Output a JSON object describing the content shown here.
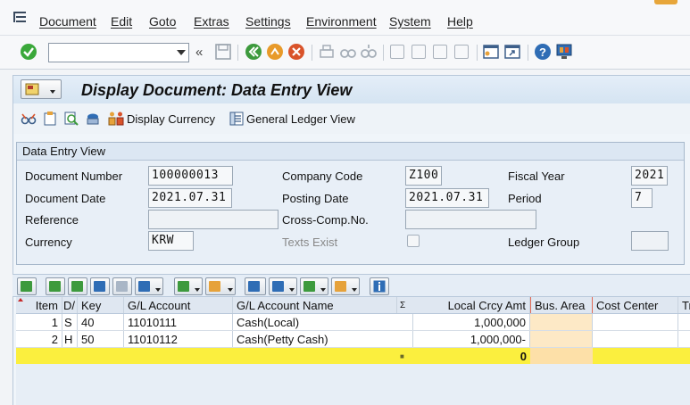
{
  "menu": {
    "items": [
      "Document",
      "Edit",
      "Goto",
      "Extras",
      "Settings",
      "Environment",
      "System",
      "Help"
    ]
  },
  "toolbar": {
    "command_value": "",
    "back_glyph": "«"
  },
  "title": {
    "text": "Display Document: Data Entry View"
  },
  "app_toolbar": {
    "display_currency": "Display Currency",
    "general_ledger_view": "General Ledger View"
  },
  "header": {
    "section_title": "Data Entry View",
    "labels": {
      "document_number": "Document Number",
      "company_code": "Company Code",
      "fiscal_year": "Fiscal Year",
      "document_date": "Document Date",
      "posting_date": "Posting Date",
      "period": "Period",
      "reference": "Reference",
      "cross_comp_no": "Cross-Comp.No.",
      "currency": "Currency",
      "texts_exist": "Texts Exist",
      "ledger_group": "Ledger Group"
    },
    "values": {
      "document_number": "100000013",
      "company_code": "Z100",
      "fiscal_year": "2021",
      "document_date": "2021.07.31",
      "posting_date": "2021.07.31",
      "period": "7",
      "reference": "",
      "cross_comp_no": "",
      "currency": "KRW",
      "ledger_group": ""
    }
  },
  "grid": {
    "columns": [
      "Item",
      "D/",
      "Key",
      "G/L Account",
      "G/L Account Name",
      "Σ",
      "Local Crcy Amt",
      "Bus. Area",
      "Cost Center",
      "Tr"
    ],
    "rows": [
      {
        "item": "1",
        "dc": "S",
        "key": "40",
        "account": "11010111",
        "name": "Cash(Local)",
        "amount": "1,000,000"
      },
      {
        "item": "2",
        "dc": "H",
        "key": "50",
        "account": "11010112",
        "name": "Cash(Petty Cash)",
        "amount": "1,000,000-"
      }
    ],
    "total": {
      "marker": "■",
      "amount": "0"
    }
  },
  "colors": {
    "sum_row": "#fbef3e",
    "bus_area_highlight": "#fde9c6",
    "confirm_green": "#3aa83a"
  }
}
